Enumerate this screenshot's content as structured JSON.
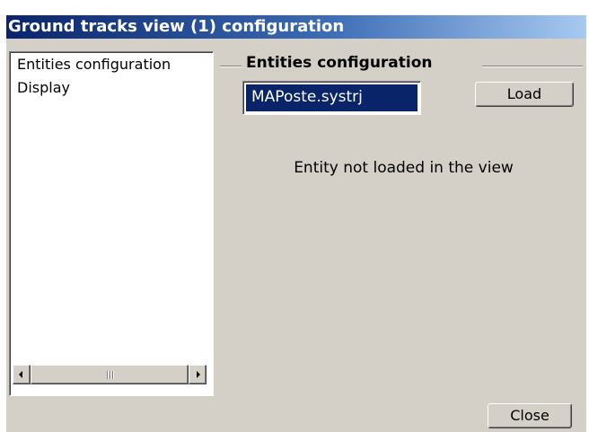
{
  "window": {
    "title": "Ground tracks view (1) configuration"
  },
  "tree": {
    "items": [
      {
        "label": "Entities configuration"
      },
      {
        "label": "Display"
      }
    ],
    "scrollbar": {
      "left_arrow_icon": "arrow-left-icon",
      "right_arrow_icon": "arrow-right-icon"
    }
  },
  "entities_config": {
    "group_title": "Entities configuration",
    "selected_entity": "MAPoste.systrj",
    "load_label": "Load",
    "status_message": "Entity not loaded in the view"
  },
  "footer": {
    "close_label": "Close"
  },
  "colors": {
    "title_bar_start": "#0a246a",
    "title_bar_end": "#a6caf0",
    "dialog_background": "#d4d0c8",
    "selection_background": "#0a246a"
  }
}
